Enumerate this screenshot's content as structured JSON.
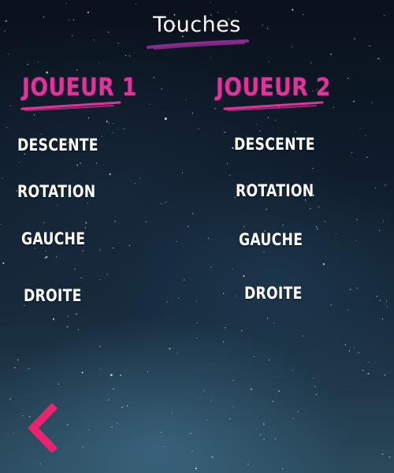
{
  "screen": {
    "title": "Touches"
  },
  "players": [
    {
      "heading": "JOUEUR 1",
      "actions": [
        "DESCENTE",
        "ROTATION",
        "GAUCHE",
        "DROITE"
      ]
    },
    {
      "heading": "JOUEUR 2",
      "actions": [
        "DESCENTE",
        "ROTATION",
        "GAUCHE",
        "DROITE"
      ]
    }
  ],
  "icons": {
    "back": "chevron-left-icon"
  },
  "colors": {
    "accent": "#e0349a",
    "title_underline": "#8a2a8c",
    "text": "#ffffff",
    "background": "#0f1c2b"
  }
}
